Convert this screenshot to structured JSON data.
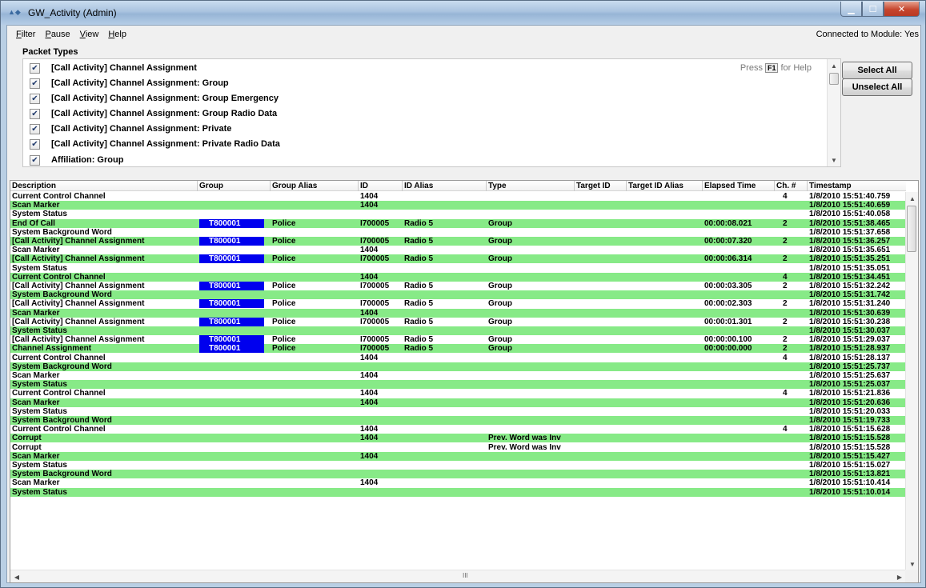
{
  "window": {
    "title": "GW_Activity (Admin)",
    "icon": "app-icon"
  },
  "menu": {
    "items": [
      {
        "label": "Filter",
        "accel": "F",
        "rest": "ilter"
      },
      {
        "label": "Pause",
        "accel": "P",
        "rest": "ause"
      },
      {
        "label": "View",
        "accel": "V",
        "rest": "iew"
      },
      {
        "label": "Help",
        "accel": "H",
        "rest": "elp"
      }
    ],
    "status": "Connected to Module: Yes"
  },
  "packet_types": {
    "label": "Packet Types",
    "help_prefix": "Press",
    "help_key": "F1",
    "help_suffix": "for Help",
    "items": [
      {
        "label": "[Call Activity] Channel Assignment",
        "checked": true
      },
      {
        "label": "[Call Activity] Channel Assignment:  Group",
        "checked": true
      },
      {
        "label": "[Call Activity] Channel Assignment:  Group Emergency",
        "checked": true
      },
      {
        "label": "[Call Activity] Channel Assignment:  Group Radio Data",
        "checked": true
      },
      {
        "label": "[Call Activity] Channel Assignment:  Private",
        "checked": true
      },
      {
        "label": "[Call Activity] Channel Assignment:  Private Radio Data",
        "checked": true
      },
      {
        "label": "Affiliation:  Group",
        "checked": true
      }
    ],
    "select_all": "Select All",
    "unselect_all": "Unselect All"
  },
  "grid": {
    "columns": [
      "Description",
      "Group",
      "Group Alias",
      "ID",
      "ID Alias",
      "Type",
      "Target ID",
      "Target ID Alias",
      "Elapsed Time",
      "Ch. #",
      "Timestamp"
    ],
    "highlight_color": "#0000ee",
    "row_green_color": "#87ea87",
    "rows": [
      {
        "green": false,
        "desc": "Current Control Channel",
        "group": "",
        "alias": "",
        "id": "1404",
        "idalias": "",
        "type": "",
        "tid": "",
        "talias": "",
        "elapsed": "",
        "ch": "4",
        "ts": "1/8/2010 15:51:40.759"
      },
      {
        "green": true,
        "desc": "Scan Marker",
        "group": "",
        "alias": "",
        "id": "1404",
        "idalias": "",
        "type": "",
        "tid": "",
        "talias": "",
        "elapsed": "",
        "ch": "",
        "ts": "1/8/2010 15:51:40.659"
      },
      {
        "green": false,
        "desc": "System Status",
        "group": "",
        "alias": "",
        "id": "",
        "idalias": "",
        "type": "",
        "tid": "",
        "talias": "",
        "elapsed": "",
        "ch": "",
        "ts": "1/8/2010 15:51:40.058"
      },
      {
        "green": true,
        "desc": "End Of Call",
        "group": "T800001",
        "alias": "Police",
        "id": "I700005",
        "idalias": "Radio 5",
        "type": "Group",
        "tid": "",
        "talias": "",
        "elapsed": "00:00:08.021",
        "ch": "2",
        "ts": "1/8/2010 15:51:38.465"
      },
      {
        "green": false,
        "desc": "System Background Word",
        "group": "",
        "alias": "",
        "id": "",
        "idalias": "",
        "type": "",
        "tid": "",
        "talias": "",
        "elapsed": "",
        "ch": "",
        "ts": "1/8/2010 15:51:37.658"
      },
      {
        "green": true,
        "desc": "[Call Activity] Channel Assignment",
        "group": "T800001",
        "alias": "Police",
        "id": "I700005",
        "idalias": "Radio 5",
        "type": "Group",
        "tid": "",
        "talias": "",
        "elapsed": "00:00:07.320",
        "ch": "2",
        "ts": "1/8/2010 15:51:36.257"
      },
      {
        "green": false,
        "desc": "Scan Marker",
        "group": "",
        "alias": "",
        "id": "1404",
        "idalias": "",
        "type": "",
        "tid": "",
        "talias": "",
        "elapsed": "",
        "ch": "",
        "ts": "1/8/2010 15:51:35.651"
      },
      {
        "green": true,
        "desc": "[Call Activity] Channel Assignment",
        "group": "T800001",
        "alias": "Police",
        "id": "I700005",
        "idalias": "Radio 5",
        "type": "Group",
        "tid": "",
        "talias": "",
        "elapsed": "00:00:06.314",
        "ch": "2",
        "ts": "1/8/2010 15:51:35.251"
      },
      {
        "green": false,
        "desc": "System Status",
        "group": "",
        "alias": "",
        "id": "",
        "idalias": "",
        "type": "",
        "tid": "",
        "talias": "",
        "elapsed": "",
        "ch": "",
        "ts": "1/8/2010 15:51:35.051"
      },
      {
        "green": true,
        "desc": "Current Control Channel",
        "group": "",
        "alias": "",
        "id": "1404",
        "idalias": "",
        "type": "",
        "tid": "",
        "talias": "",
        "elapsed": "",
        "ch": "4",
        "ts": "1/8/2010 15:51:34.451"
      },
      {
        "green": false,
        "desc": "[Call Activity] Channel Assignment",
        "group": "T800001",
        "alias": "Police",
        "id": "I700005",
        "idalias": "Radio 5",
        "type": "Group",
        "tid": "",
        "talias": "",
        "elapsed": "00:00:03.305",
        "ch": "2",
        "ts": "1/8/2010 15:51:32.242"
      },
      {
        "green": true,
        "desc": "System Background Word",
        "group": "",
        "alias": "",
        "id": "",
        "idalias": "",
        "type": "",
        "tid": "",
        "talias": "",
        "elapsed": "",
        "ch": "",
        "ts": "1/8/2010 15:51:31.742"
      },
      {
        "green": false,
        "desc": "[Call Activity] Channel Assignment",
        "group": "T800001",
        "alias": "Police",
        "id": "I700005",
        "idalias": "Radio 5",
        "type": "Group",
        "tid": "",
        "talias": "",
        "elapsed": "00:00:02.303",
        "ch": "2",
        "ts": "1/8/2010 15:51:31.240"
      },
      {
        "green": true,
        "desc": "Scan Marker",
        "group": "",
        "alias": "",
        "id": "1404",
        "idalias": "",
        "type": "",
        "tid": "",
        "talias": "",
        "elapsed": "",
        "ch": "",
        "ts": "1/8/2010 15:51:30.639"
      },
      {
        "green": false,
        "desc": "[Call Activity] Channel Assignment",
        "group": "T800001",
        "alias": "Police",
        "id": "I700005",
        "idalias": "Radio 5",
        "type": "Group",
        "tid": "",
        "talias": "",
        "elapsed": "00:00:01.301",
        "ch": "2",
        "ts": "1/8/2010 15:51:30.238"
      },
      {
        "green": true,
        "desc": "System Status",
        "group": "",
        "alias": "",
        "id": "",
        "idalias": "",
        "type": "",
        "tid": "",
        "talias": "",
        "elapsed": "",
        "ch": "",
        "ts": "1/8/2010 15:51:30.037"
      },
      {
        "green": false,
        "desc": "[Call Activity] Channel Assignment",
        "group": "T800001",
        "alias": "Police",
        "id": "I700005",
        "idalias": "Radio 5",
        "type": "Group",
        "tid": "",
        "talias": "",
        "elapsed": "00:00:00.100",
        "ch": "2",
        "ts": "1/8/2010 15:51:29.037"
      },
      {
        "green": true,
        "desc": "Channel Assignment",
        "group": "T800001",
        "alias": "Police",
        "id": "I700005",
        "idalias": "Radio 5",
        "type": "Group",
        "tid": "",
        "talias": "",
        "elapsed": "00:00:00.000",
        "ch": "2",
        "ts": "1/8/2010 15:51:28.937"
      },
      {
        "green": false,
        "desc": "Current Control Channel",
        "group": "",
        "alias": "",
        "id": "1404",
        "idalias": "",
        "type": "",
        "tid": "",
        "talias": "",
        "elapsed": "",
        "ch": "4",
        "ts": "1/8/2010 15:51:28.137"
      },
      {
        "green": true,
        "desc": "System Background Word",
        "group": "",
        "alias": "",
        "id": "",
        "idalias": "",
        "type": "",
        "tid": "",
        "talias": "",
        "elapsed": "",
        "ch": "",
        "ts": "1/8/2010 15:51:25.737"
      },
      {
        "green": false,
        "desc": "Scan Marker",
        "group": "",
        "alias": "",
        "id": "1404",
        "idalias": "",
        "type": "",
        "tid": "",
        "talias": "",
        "elapsed": "",
        "ch": "",
        "ts": "1/8/2010 15:51:25.637"
      },
      {
        "green": true,
        "desc": "System Status",
        "group": "",
        "alias": "",
        "id": "",
        "idalias": "",
        "type": "",
        "tid": "",
        "talias": "",
        "elapsed": "",
        "ch": "",
        "ts": "1/8/2010 15:51:25.037"
      },
      {
        "green": false,
        "desc": "Current Control Channel",
        "group": "",
        "alias": "",
        "id": "1404",
        "idalias": "",
        "type": "",
        "tid": "",
        "talias": "",
        "elapsed": "",
        "ch": "4",
        "ts": "1/8/2010 15:51:21.836"
      },
      {
        "green": true,
        "desc": "Scan Marker",
        "group": "",
        "alias": "",
        "id": "1404",
        "idalias": "",
        "type": "",
        "tid": "",
        "talias": "",
        "elapsed": "",
        "ch": "",
        "ts": "1/8/2010 15:51:20.636"
      },
      {
        "green": false,
        "desc": "System Status",
        "group": "",
        "alias": "",
        "id": "",
        "idalias": "",
        "type": "",
        "tid": "",
        "talias": "",
        "elapsed": "",
        "ch": "",
        "ts": "1/8/2010 15:51:20.033"
      },
      {
        "green": true,
        "desc": "System Background Word",
        "group": "",
        "alias": "",
        "id": "",
        "idalias": "",
        "type": "",
        "tid": "",
        "talias": "",
        "elapsed": "",
        "ch": "",
        "ts": "1/8/2010 15:51:19.733"
      },
      {
        "green": false,
        "desc": "Current Control Channel",
        "group": "",
        "alias": "",
        "id": "1404",
        "idalias": "",
        "type": "",
        "tid": "",
        "talias": "",
        "elapsed": "",
        "ch": "4",
        "ts": "1/8/2010 15:51:15.628"
      },
      {
        "green": true,
        "desc": "Corrupt",
        "group": "",
        "alias": "",
        "id": "1404",
        "idalias": "",
        "type": "Prev. Word was Inv",
        "tid": "",
        "talias": "",
        "elapsed": "",
        "ch": "",
        "ts": "1/8/2010 15:51:15.528"
      },
      {
        "green": false,
        "desc": "Corrupt",
        "group": "",
        "alias": "",
        "id": "",
        "idalias": "",
        "type": "Prev. Word was Inv",
        "tid": "",
        "talias": "",
        "elapsed": "",
        "ch": "",
        "ts": "1/8/2010 15:51:15.528"
      },
      {
        "green": true,
        "desc": "Scan Marker",
        "group": "",
        "alias": "",
        "id": "1404",
        "idalias": "",
        "type": "",
        "tid": "",
        "talias": "",
        "elapsed": "",
        "ch": "",
        "ts": "1/8/2010 15:51:15.427"
      },
      {
        "green": false,
        "desc": "System Status",
        "group": "",
        "alias": "",
        "id": "",
        "idalias": "",
        "type": "",
        "tid": "",
        "talias": "",
        "elapsed": "",
        "ch": "",
        "ts": "1/8/2010 15:51:15.027"
      },
      {
        "green": true,
        "desc": "System Background Word",
        "group": "",
        "alias": "",
        "id": "",
        "idalias": "",
        "type": "",
        "tid": "",
        "talias": "",
        "elapsed": "",
        "ch": "",
        "ts": "1/8/2010 15:51:13.821"
      },
      {
        "green": false,
        "desc": "Scan Marker",
        "group": "",
        "alias": "",
        "id": "1404",
        "idalias": "",
        "type": "",
        "tid": "",
        "talias": "",
        "elapsed": "",
        "ch": "",
        "ts": "1/8/2010 15:51:10.414"
      },
      {
        "green": true,
        "desc": "System Status",
        "group": "",
        "alias": "",
        "id": "",
        "idalias": "",
        "type": "",
        "tid": "",
        "talias": "",
        "elapsed": "",
        "ch": "",
        "ts": "1/8/2010 15:51:10.014"
      }
    ],
    "hscroll_grip": "III"
  }
}
